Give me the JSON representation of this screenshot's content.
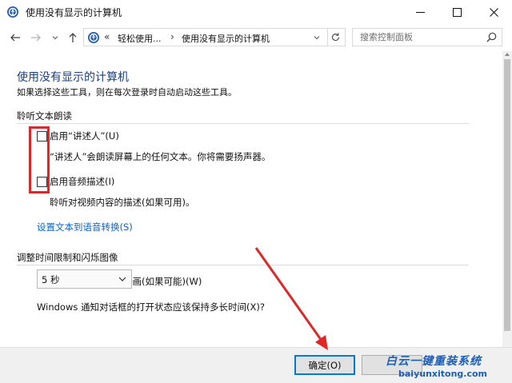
{
  "window": {
    "title": "使用没有显示的计算机",
    "icon": "ease-of-access-icon"
  },
  "address": {
    "prefix": "«",
    "crumbs": [
      "轻松使用...",
      "使用没有显示的计算机"
    ],
    "separator": "›"
  },
  "search": {
    "placeholder": "搜索控制面板"
  },
  "page": {
    "title": "使用没有显示的计算机",
    "subtitle": "如果选择这些工具，则在每次登录时自动启动这些工具。"
  },
  "sections": {
    "narration": {
      "title": "聆听文本朗读",
      "narrator_label": "启用“讲述人”(U)",
      "narrator_desc": "“讲述人”会朗读屏幕上的任何文本。你将需要扬声器。",
      "audio_desc_label": "启用音频描述(I)",
      "audio_desc_desc": "聆听对视频内容的描述(如果可用)。",
      "tts_link": "设置文本到语音转换(S)"
    },
    "timing": {
      "title": "调整时间限制和闪烁图像",
      "animations_label": "关闭所有不必要的动画(如果可能)(W)",
      "notify_question": "Windows 通知对话框的打开状态应该保持多长时间(X)?",
      "notify_value": "5 秒"
    }
  },
  "footer": {
    "ok_label": "确定(O)"
  },
  "watermark": {
    "cn": "白云一键重装系统",
    "en": "baiyunxitong.com"
  },
  "colors": {
    "accent": "#0078d7",
    "link": "#0b63c4",
    "title": "#1e3f80",
    "annotation": "#e02727"
  }
}
